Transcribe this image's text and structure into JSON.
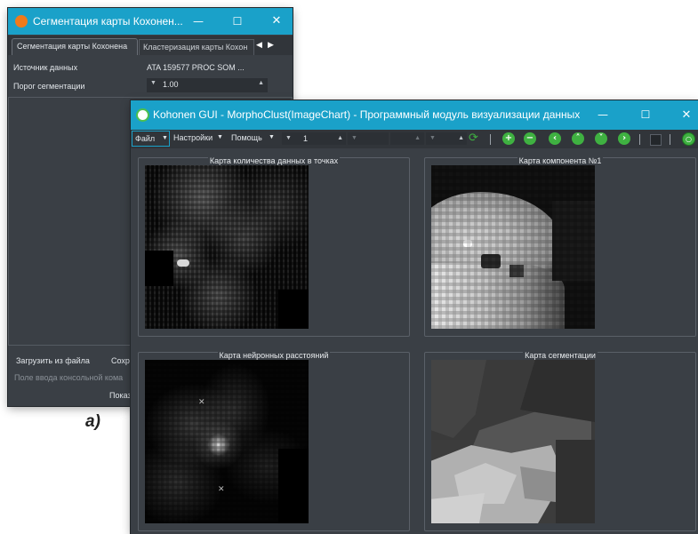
{
  "back_window": {
    "title": "Сегментация карты Кохонен...",
    "tabs": [
      "Сегментация карты Кохонена",
      "Кластеризация карты Кохон"
    ],
    "fields": [
      {
        "label": "Источник данных",
        "value": "ATA 159577 PROC SOM  ..."
      },
      {
        "label": "Порог сегментации",
        "value": "1.00"
      }
    ],
    "load_button": "Загрузить из файла",
    "save_button": "Сохр",
    "console_placeholder": "Поле ввода консольной кома",
    "show_button": "Показ"
  },
  "front_window": {
    "title": "Kohonen GUI - MorphoClust(ImageChart) - Программный модуль визуализации данных",
    "menu": {
      "file": "Файл",
      "settings": "Настройки",
      "help": "Помощь"
    },
    "spin_value": "1",
    "panels": [
      {
        "title": "Карта количества данных в точках"
      },
      {
        "title": "Карта компонента №1"
      },
      {
        "title": "Карта нейронных расстояний"
      },
      {
        "title": "Карта сегментации"
      }
    ]
  },
  "caption": "a)",
  "colors": {
    "titlebar": "#1aa1c9",
    "window_bg": "#3a3f45",
    "accent_green": "#3fb141"
  },
  "icons": [
    "minimize-icon",
    "maximize-icon",
    "close-icon",
    "refresh-icon",
    "plus-icon",
    "minus-icon",
    "arrow-left-icon",
    "arrow-up-icon",
    "arrow-down-icon",
    "arrow-right-icon",
    "app-icon"
  ]
}
